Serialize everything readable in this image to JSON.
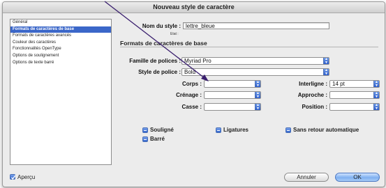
{
  "window": {
    "title": "Nouveau style de caractère"
  },
  "sidebar": {
    "items": [
      {
        "label": "Général"
      },
      {
        "label": "Formats de caractères de base"
      },
      {
        "label": "Formats de caractères avancés"
      },
      {
        "label": "Couleur des caractères"
      },
      {
        "label": "Fonctionnalités OpenType"
      },
      {
        "label": "Options de soulignement"
      },
      {
        "label": "Options de texte barré"
      }
    ]
  },
  "form": {
    "style_name_label": "Nom du style :",
    "style_name_value": "lettre_bleue",
    "state_label": "Etat :",
    "section_title": "Formats de caractères de base",
    "font_family_label": "Famille de polices :",
    "font_family_value": "Myriad Pro",
    "font_style_label": "Style de police :",
    "font_style_value": "Bold",
    "size_label": "Corps :",
    "size_value": "",
    "leading_label": "Interligne :",
    "leading_value": "14 pt",
    "kerning_label": "Crénage :",
    "kerning_value": "",
    "tracking_label": "Approche :",
    "tracking_value": "",
    "case_label": "Casse :",
    "case_value": "",
    "position_label": "Position :",
    "position_value": ""
  },
  "options": {
    "underline": "Souligné",
    "ligatures": "Ligatures",
    "no_break": "Sans retour automatique",
    "strikethrough": "Barré"
  },
  "footer": {
    "preview_label": "Aperçu",
    "cancel": "Annuler",
    "ok": "OK"
  },
  "colors": {
    "accent": "#3b67c9",
    "arrow": "#3a1f6e"
  }
}
